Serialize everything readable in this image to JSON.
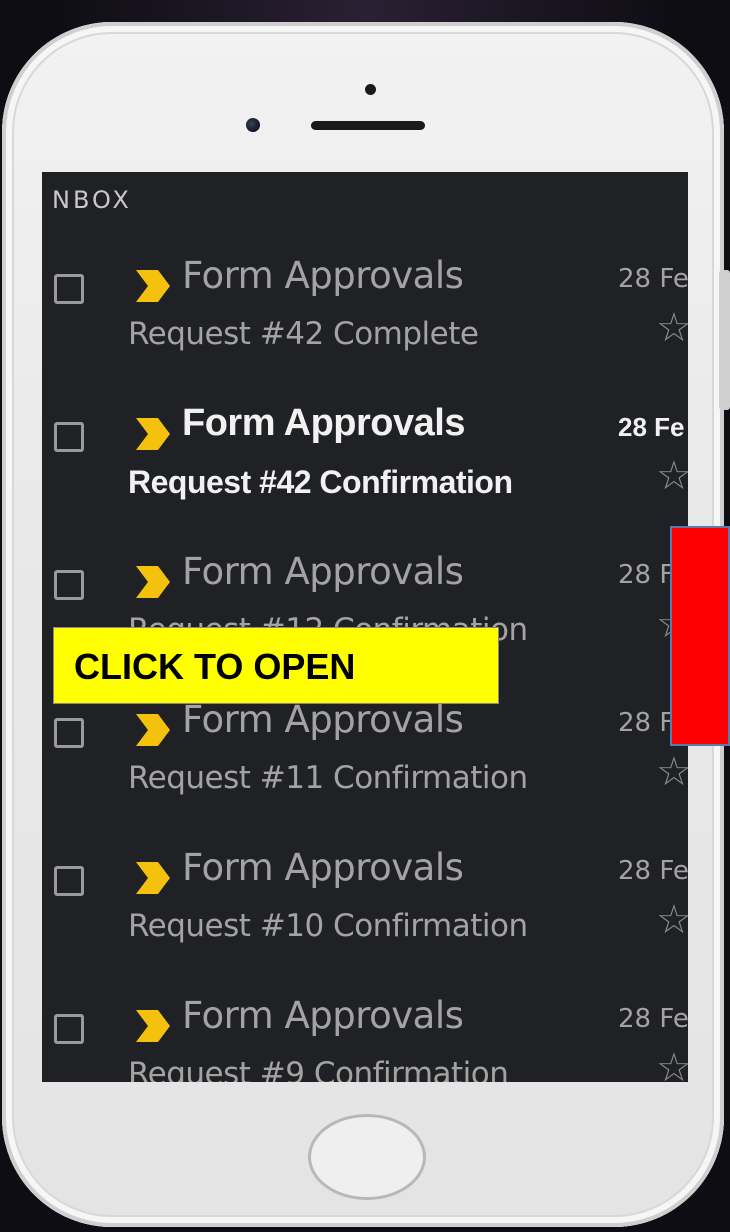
{
  "inbox": {
    "label": "NBOX"
  },
  "emails": [
    {
      "sender": "Form Approvals",
      "subject": "Request #42 Complete",
      "date": "28 Fe",
      "unread": false
    },
    {
      "sender": "Form Approvals",
      "subject": "Request #42 Confirmation",
      "date": "28 Fe",
      "unread": true
    },
    {
      "sender": "Form Approvals",
      "subject": "Request #12 Confirmation",
      "date": "28 F",
      "unread": false
    },
    {
      "sender": "Form Approvals",
      "subject": "Request #11 Confirmation",
      "date": "28 F",
      "unread": false
    },
    {
      "sender": "Form Approvals",
      "subject": "Request #10 Confirmation",
      "date": "28 Fe",
      "unread": false
    },
    {
      "sender": "Form Approvals",
      "subject": "Request #9 Confirmation",
      "date": "28 Fe",
      "unread": false
    }
  ],
  "icons": {
    "importance": "importance-marker-icon",
    "star": "star-icon",
    "checkbox": "checkbox-icon"
  },
  "colors": {
    "screen_bg": "#202124",
    "importance_marker": "#f4c20d",
    "banner_bg": "#ffff00",
    "red_overlay": "#ff0000"
  },
  "overlay": {
    "cta_label": "CLICK TO OPEN"
  }
}
